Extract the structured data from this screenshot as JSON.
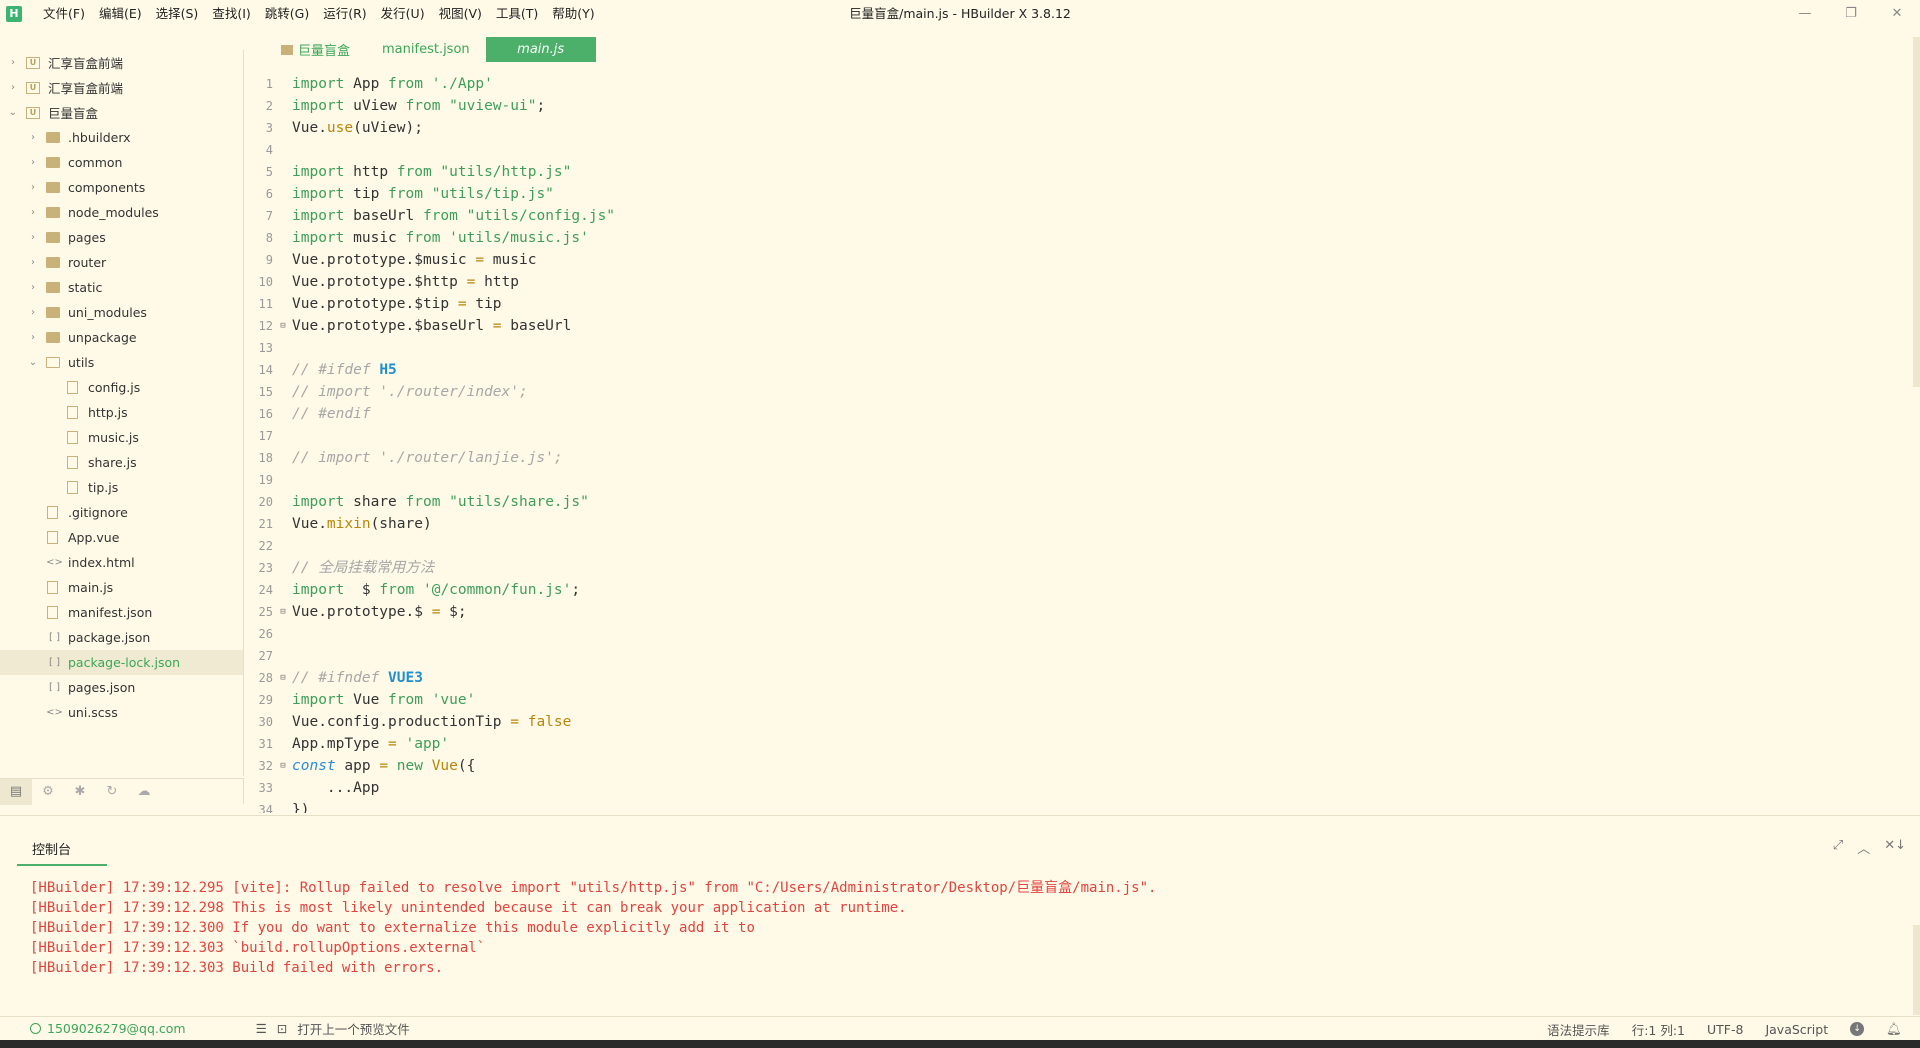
{
  "window": {
    "logo": "H",
    "title": "巨量盲盒/main.js - HBuilder X 3.8.12",
    "menu": [
      "文件(F)",
      "编辑(E)",
      "选择(S)",
      "查找(I)",
      "跳转(G)",
      "运行(R)",
      "发行(U)",
      "视图(V)",
      "工具(T)",
      "帮助(Y)"
    ]
  },
  "sidebar": {
    "items": [
      {
        "label": "汇享盲盒前端",
        "type": "project",
        "depth": 0,
        "arrow": "›"
      },
      {
        "label": "汇享盲盒前端",
        "type": "project",
        "depth": 0,
        "arrow": "›"
      },
      {
        "label": "巨量盲盒",
        "type": "project",
        "depth": 0,
        "arrow": "⌄"
      },
      {
        "label": ".hbuilderx",
        "type": "folder",
        "depth": 1,
        "arrow": "›"
      },
      {
        "label": "common",
        "type": "folder",
        "depth": 1,
        "arrow": "›"
      },
      {
        "label": "components",
        "type": "folder",
        "depth": 1,
        "arrow": "›"
      },
      {
        "label": "node_modules",
        "type": "folder",
        "depth": 1,
        "arrow": "›"
      },
      {
        "label": "pages",
        "type": "folder",
        "depth": 1,
        "arrow": "›"
      },
      {
        "label": "router",
        "type": "folder",
        "depth": 1,
        "arrow": "›"
      },
      {
        "label": "static",
        "type": "folder",
        "depth": 1,
        "arrow": "›"
      },
      {
        "label": "uni_modules",
        "type": "folder",
        "depth": 1,
        "arrow": "›"
      },
      {
        "label": "unpackage",
        "type": "folder",
        "depth": 1,
        "arrow": "›"
      },
      {
        "label": "utils",
        "type": "folder-open",
        "depth": 1,
        "arrow": "⌄"
      },
      {
        "label": "config.js",
        "type": "file",
        "depth": 2,
        "arrow": ""
      },
      {
        "label": "http.js",
        "type": "file",
        "depth": 2,
        "arrow": ""
      },
      {
        "label": "music.js",
        "type": "file",
        "depth": 2,
        "arrow": ""
      },
      {
        "label": "share.js",
        "type": "file",
        "depth": 2,
        "arrow": ""
      },
      {
        "label": "tip.js",
        "type": "file",
        "depth": 2,
        "arrow": ""
      },
      {
        "label": ".gitignore",
        "type": "file",
        "depth": 1,
        "arrow": ""
      },
      {
        "label": "App.vue",
        "type": "file",
        "depth": 1,
        "arrow": ""
      },
      {
        "label": "index.html",
        "type": "code",
        "depth": 1,
        "arrow": ""
      },
      {
        "label": "main.js",
        "type": "file",
        "depth": 1,
        "arrow": ""
      },
      {
        "label": "manifest.json",
        "type": "file",
        "depth": 1,
        "arrow": ""
      },
      {
        "label": "package.json",
        "type": "json",
        "depth": 1,
        "arrow": ""
      },
      {
        "label": "package-lock.json",
        "type": "json",
        "depth": 1,
        "arrow": "",
        "selected": true
      },
      {
        "label": "pages.json",
        "type": "json",
        "depth": 1,
        "arrow": ""
      },
      {
        "label": "uni.scss",
        "type": "code",
        "depth": 1,
        "arrow": ""
      }
    ]
  },
  "tabs": [
    {
      "label": "巨量盲盒",
      "folder": true
    },
    {
      "label": "manifest.json"
    },
    {
      "label": "main.js",
      "active": true
    }
  ],
  "code": [
    {
      "n": "1",
      "t": [
        [
          "kw",
          "import"
        ],
        [
          "",
          "App "
        ],
        [
          "kw",
          "from"
        ],
        [
          "",
          ""
        ],
        [
          "str",
          " './App'"
        ]
      ]
    },
    {
      "n": "2",
      "t": [
        [
          "kw",
          "import"
        ],
        [
          "",
          "uView "
        ],
        [
          "kw",
          "from"
        ],
        [
          "str",
          " \"uview-ui\""
        ],
        [
          "",
          ";"
        ]
      ]
    },
    {
      "n": "3",
      "t": [
        [
          "",
          "Vue."
        ],
        [
          "fn",
          "use"
        ],
        [
          "",
          "(uView);"
        ]
      ]
    },
    {
      "n": "4",
      "t": []
    },
    {
      "n": "5",
      "t": [
        [
          "kw",
          "import"
        ],
        [
          "",
          "http "
        ],
        [
          "kw",
          "from"
        ],
        [
          "str",
          " \"utils/http.js\""
        ]
      ]
    },
    {
      "n": "6",
      "t": [
        [
          "kw",
          "import"
        ],
        [
          "",
          "tip "
        ],
        [
          "kw",
          "from"
        ],
        [
          "str",
          " \"utils/tip.js\""
        ]
      ]
    },
    {
      "n": "7",
      "t": [
        [
          "kw",
          "import"
        ],
        [
          "",
          "baseUrl "
        ],
        [
          "kw",
          "from"
        ],
        [
          "str",
          " \"utils/config.js\""
        ]
      ]
    },
    {
      "n": "8",
      "t": [
        [
          "kw",
          "import"
        ],
        [
          "",
          "music "
        ],
        [
          "kw",
          "from"
        ],
        [
          "str",
          " 'utils/music.js'"
        ]
      ]
    },
    {
      "n": "9",
      "t": [
        [
          "",
          "Vue.prototype.$music "
        ],
        [
          "op",
          "="
        ],
        [
          "",
          " music"
        ]
      ]
    },
    {
      "n": "10",
      "t": [
        [
          "",
          "Vue.prototype.$http "
        ],
        [
          "op",
          "="
        ],
        [
          "",
          " http"
        ]
      ]
    },
    {
      "n": "11",
      "t": [
        [
          "",
          "Vue.prototype.$tip "
        ],
        [
          "op",
          "="
        ],
        [
          "",
          " tip"
        ]
      ]
    },
    {
      "n": "12",
      "fold": true,
      "t": [
        [
          "",
          "Vue.prototype.$baseUrl "
        ],
        [
          "op",
          "="
        ],
        [
          "",
          " baseUrl"
        ]
      ]
    },
    {
      "n": "13",
      "t": []
    },
    {
      "n": "14",
      "t": [
        [
          "cm",
          "// #ifdef "
        ],
        [
          "dir",
          "H5"
        ]
      ]
    },
    {
      "n": "15",
      "t": [
        [
          "cm",
          "// import './router/index';"
        ]
      ]
    },
    {
      "n": "16",
      "t": [
        [
          "cm",
          "// #endif"
        ]
      ]
    },
    {
      "n": "17",
      "t": []
    },
    {
      "n": "18",
      "t": [
        [
          "cm",
          "// import './router/lanjie.js';"
        ]
      ]
    },
    {
      "n": "19",
      "t": []
    },
    {
      "n": "20",
      "t": [
        [
          "kw",
          "import"
        ],
        [
          "",
          "share "
        ],
        [
          "kw",
          "from"
        ],
        [
          "str",
          " \"utils/share.js\""
        ]
      ]
    },
    {
      "n": "21",
      "t": [
        [
          "",
          "Vue."
        ],
        [
          "fn",
          "mixin"
        ],
        [
          "",
          "(share)"
        ]
      ]
    },
    {
      "n": "22",
      "t": []
    },
    {
      "n": "23",
      "t": [
        [
          "cm",
          "// 全局挂载常用方法"
        ]
      ]
    },
    {
      "n": "24",
      "t": [
        [
          "kw",
          "import"
        ],
        [
          "",
          " $ "
        ],
        [
          "kw",
          "from"
        ],
        [
          "str",
          " '@/common/fun.js'"
        ],
        [
          "",
          ";"
        ]
      ]
    },
    {
      "n": "25",
      "fold": true,
      "t": [
        [
          "",
          "Vue.prototype.$ "
        ],
        [
          "op",
          "="
        ],
        [
          "",
          " $;"
        ]
      ]
    },
    {
      "n": "26",
      "t": []
    },
    {
      "n": "27",
      "t": []
    },
    {
      "n": "28",
      "fold": true,
      "t": [
        [
          "cm",
          "// #ifndef "
        ],
        [
          "dir",
          "VUE3"
        ]
      ]
    },
    {
      "n": "29",
      "t": [
        [
          "kw",
          "import"
        ],
        [
          "",
          "Vue "
        ],
        [
          "kw",
          "from"
        ],
        [
          "str",
          " 'vue'"
        ]
      ]
    },
    {
      "n": "30",
      "t": [
        [
          "",
          "Vue.config.productionTip "
        ],
        [
          "op",
          "="
        ],
        [
          "op",
          " false"
        ]
      ]
    },
    {
      "n": "31",
      "t": [
        [
          "",
          "App.mpType "
        ],
        [
          "op",
          "="
        ],
        [
          "str",
          " 'app'"
        ]
      ]
    },
    {
      "n": "32",
      "fold": true,
      "t": [
        [
          "kwit",
          "const"
        ],
        [
          "",
          " app "
        ],
        [
          "op",
          "="
        ],
        [
          "kw",
          " new"
        ],
        [
          "fn",
          " Vue"
        ],
        [
          "",
          "({"
        ]
      ]
    },
    {
      "n": "33",
      "t": [
        [
          "",
          "    ...App"
        ]
      ]
    },
    {
      "n": "34",
      "t": [
        [
          "",
          "})"
        ]
      ]
    }
  ],
  "console": {
    "tab": "控制台",
    "lines": [
      "[HBuilder] 17:39:12.295 [vite]: Rollup failed to resolve import \"utils/http.js\" from \"C:/Users/Administrator/Desktop/巨量盲盒/main.js\".",
      "[HBuilder] 17:39:12.298 This is most likely unintended because it can break your application at runtime.",
      "[HBuilder] 17:39:12.300 If you do want to externalize this module explicitly add it to",
      "[HBuilder] 17:39:12.303 `build.rollupOptions.external`",
      "[HBuilder] 17:39:12.303 Build failed with errors."
    ]
  },
  "status": {
    "user": "1509026279@qq.com",
    "preview": "打开上一个预览文件",
    "syntax": "语法提示库",
    "position": "行:1  列:1",
    "encoding": "UTF-8",
    "language": "JavaScript"
  }
}
